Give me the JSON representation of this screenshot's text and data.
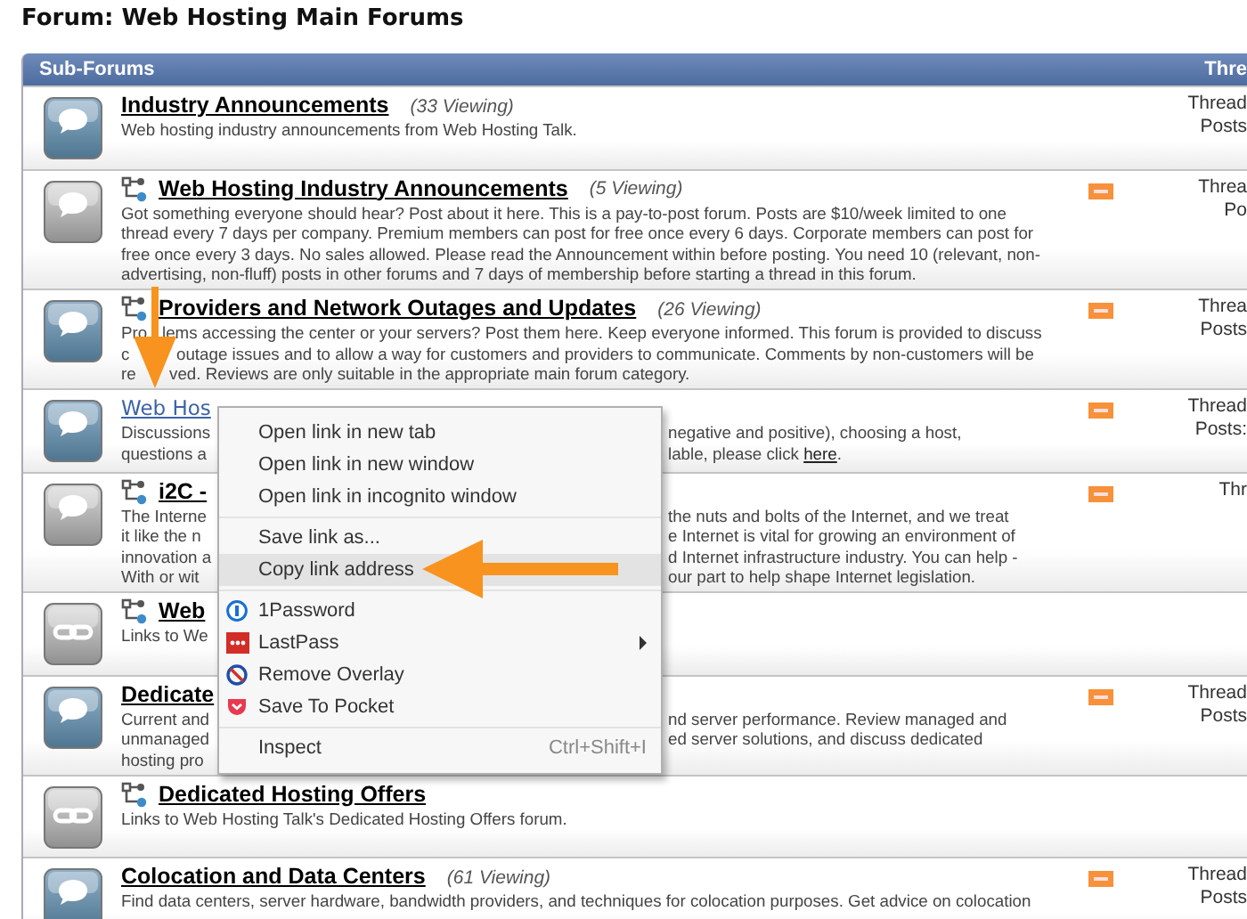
{
  "page_title": "Forum: Web Hosting Main Forums",
  "table": {
    "header": "Sub-Forums",
    "header_right": "Thre"
  },
  "rows": [
    {
      "kind": "bubble",
      "new_posts": true,
      "subforum_link": false,
      "title": "Industry Announcements",
      "hovered": false,
      "viewing": "(33 Viewing)",
      "description": "Web hosting industry announcements from Web Hosting Talk.",
      "rss": false,
      "stats": [
        "Thread",
        "Posts"
      ]
    },
    {
      "kind": "bubble",
      "new_posts": false,
      "subforum_link": true,
      "title": "Web Hosting Industry Announcements",
      "hovered": false,
      "viewing": "(5 Viewing)",
      "description": "Got something everyone should hear? Post about it here. This is a pay-to-post forum. Posts are $10/week limited to one thread every 7 days per company. Premium members can post for free once every 6 days. Corporate members can post for free once every 3 days. No sales allowed. Please read the Announcement within before posting. You need 10 (relevant, non-advertising, non-fluff) posts in other forums and 7 days of membership before starting a thread in this forum.",
      "rss": true,
      "stats": [
        "Threa",
        "Po"
      ]
    },
    {
      "kind": "bubble",
      "new_posts": true,
      "subforum_link": true,
      "title": "Providers and Network Outages and Updates",
      "hovered": false,
      "viewing": "(26 Viewing)",
      "description_parts": [
        {
          "left": "Pro",
          "right": "lems accessing the center or your servers? Post them here. Keep everyone informed. This forum is provided to discuss"
        },
        {
          "left": "c",
          "right": "outage issues and to allow a way for customers and providers to communicate. Comments by non-customers will be"
        },
        {
          "left": "re",
          "right": "ved. Reviews are only suitable in the appropriate main forum category."
        }
      ],
      "rss": true,
      "stats": [
        "Threa",
        "Posts"
      ]
    },
    {
      "kind": "bubble",
      "new_posts": true,
      "subforum_link": false,
      "title": "Web Hos",
      "hovered": true,
      "description_parts": [
        {
          "left": "Discussions",
          "right": "negative and positive), choosing a host,"
        },
        {
          "left": "questions a",
          "right": "lable, please click",
          "link": "here",
          "after": "."
        }
      ],
      "rss": true,
      "stats": [
        "Thread",
        "Posts:"
      ]
    },
    {
      "kind": "bubble",
      "new_posts": false,
      "subforum_link": true,
      "title": "i2C -",
      "hovered": false,
      "description_parts": [
        {
          "left": "The Interne",
          "right": "the nuts and bolts of the Internet, and we treat"
        },
        {
          "left": "it like the n",
          "right": "e Internet is vital for growing an environment of"
        },
        {
          "left": "innovation a",
          "right": "d Internet infrastructure industry. You can help -"
        },
        {
          "left": "With or wit",
          "right": "our part to help shape Internet legislation."
        }
      ],
      "rss": true,
      "stats": [
        "Thr"
      ]
    },
    {
      "kind": "link",
      "new_posts": false,
      "subforum_link": true,
      "title": "Web",
      "hovered": false,
      "description_parts": [
        {
          "left": "Links to We"
        }
      ],
      "rss": false,
      "stats": []
    },
    {
      "kind": "bubble",
      "new_posts": true,
      "subforum_link": false,
      "title": "Dedicate",
      "hovered": false,
      "description_parts": [
        {
          "left": "Current and",
          "right": "nd server performance. Review managed and"
        },
        {
          "left": "unmanaged",
          "right": "ed server solutions, and discuss dedicated"
        },
        {
          "left": "hosting pro"
        }
      ],
      "rss": true,
      "stats": [
        "Thread",
        "Posts"
      ]
    },
    {
      "kind": "link",
      "new_posts": false,
      "subforum_link": true,
      "title": "Dedicated Hosting Offers",
      "hovered": false,
      "description": "Links to Web Hosting Talk's Dedicated Hosting Offers forum.",
      "rss": false,
      "stats": []
    },
    {
      "kind": "bubble",
      "new_posts": true,
      "subforum_link": false,
      "title": "Colocation and Data Centers",
      "hovered": false,
      "viewing": "(61 Viewing)",
      "description": "Find data centers, server hardware, bandwidth providers, and techniques for colocation purposes. Get advice on colocation",
      "rss": true,
      "stats": [
        "Thread",
        "Posts"
      ]
    }
  ],
  "context_menu": {
    "groups": [
      [
        {
          "label": "Open link in new tab",
          "selected": false
        },
        {
          "label": "Open link in new window",
          "selected": false
        },
        {
          "label": "Open link in incognito window",
          "selected": false
        }
      ],
      [
        {
          "label": "Save link as...",
          "selected": false
        },
        {
          "label": "Copy link address",
          "selected": true
        }
      ],
      [
        {
          "label": "1Password",
          "selected": false,
          "kind": "keyhole"
        },
        {
          "label": "LastPass",
          "selected": false,
          "kind": "dots",
          "submenu": true
        },
        {
          "label": "Remove Overlay",
          "selected": false,
          "kind": "prohibited"
        },
        {
          "label": "Save To Pocket",
          "selected": false,
          "kind": "pocket"
        }
      ],
      [
        {
          "label": "Inspect",
          "selected": false,
          "shortcut": "Ctrl+Shift+I"
        }
      ]
    ]
  }
}
